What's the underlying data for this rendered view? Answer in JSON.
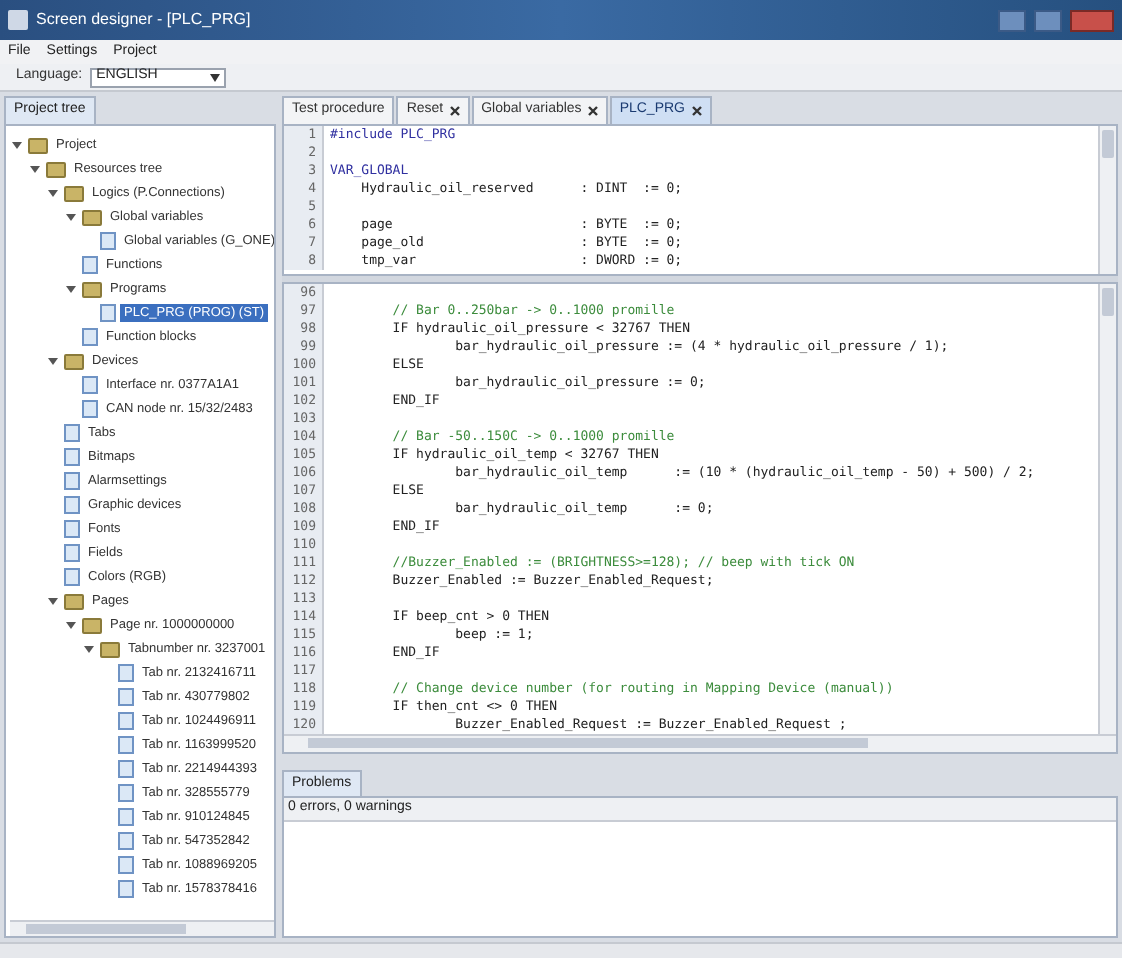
{
  "window": {
    "title": "Screen designer - [PLC_PRG]"
  },
  "menu": [
    "File",
    "Settings",
    "Project"
  ],
  "toolbar": {
    "label": "Language:",
    "value": "ENGLISH"
  },
  "sidebar": {
    "tab": "Project tree",
    "tree": [
      {
        "label": "Project",
        "expanded": true,
        "selected": false,
        "children": [
          {
            "label": "Resources tree",
            "expanded": true,
            "selected": false,
            "children": [
              {
                "label": "Logics (P.Connections)",
                "expanded": true,
                "selected": false,
                "children": [
                  {
                    "label": "Global variables",
                    "expanded": true,
                    "selected": false,
                    "children": [
                      {
                        "label": "Global variables (G_ONE)",
                        "selected": false
                      }
                    ]
                  },
                  {
                    "label": "Functions",
                    "selected": false
                  },
                  {
                    "label": "Programs",
                    "expanded": true,
                    "selected": false,
                    "children": [
                      {
                        "label": "PLC_PRG (PROG) (ST)",
                        "selected": true
                      }
                    ]
                  },
                  {
                    "label": "Function blocks",
                    "selected": false
                  }
                ]
              },
              {
                "label": "Devices",
                "expanded": true,
                "selected": false,
                "children": [
                  {
                    "label": "Interface nr. 0377A1A1",
                    "selected": false
                  },
                  {
                    "label": "CAN node nr. 15/32/2483",
                    "selected": false
                  }
                ]
              },
              {
                "label": "Tabs",
                "selected": false
              },
              {
                "label": "Bitmaps",
                "selected": false
              },
              {
                "label": "Alarmsettings",
                "selected": false
              },
              {
                "label": "Graphic devices",
                "selected": false
              },
              {
                "label": "Fonts",
                "selected": false
              },
              {
                "label": "Fields",
                "selected": false
              },
              {
                "label": "Colors (RGB)",
                "selected": false
              },
              {
                "label": "Pages",
                "expanded": true,
                "selected": false,
                "children": [
                  {
                    "label": "Page nr. 1000000000",
                    "expanded": true,
                    "selected": false,
                    "children": [
                      {
                        "label": "Tabnumber nr. 3237001",
                        "expanded": true,
                        "selected": false,
                        "children": [
                          {
                            "label": "Tab nr. 2132416711",
                            "selected": false
                          },
                          {
                            "label": "Tab nr. 430779802",
                            "selected": false
                          },
                          {
                            "label": "Tab nr. 1024496911",
                            "selected": false
                          },
                          {
                            "label": "Tab nr. 1163999520",
                            "selected": false
                          },
                          {
                            "label": "Tab nr. 2214944393",
                            "selected": false
                          },
                          {
                            "label": "Tab nr. 328555779",
                            "selected": false
                          },
                          {
                            "label": "Tab nr. 910124845",
                            "selected": false
                          },
                          {
                            "label": "Tab nr. 547352842",
                            "selected": false
                          },
                          {
                            "label": "Tab nr. 1088969205",
                            "selected": false
                          },
                          {
                            "label": "Tab nr. 1578378416",
                            "selected": false
                          }
                        ]
                      }
                    ]
                  }
                ]
              }
            ]
          }
        ]
      }
    ]
  },
  "editor_tabs": [
    {
      "label": "Test procedure",
      "selected": false,
      "closable": false
    },
    {
      "label": "Reset",
      "selected": false,
      "closable": true
    },
    {
      "label": "Global variables",
      "selected": false,
      "closable": true
    },
    {
      "label": "PLC_PRG",
      "selected": true,
      "closable": true
    }
  ],
  "declarations": [
    {
      "no": "1",
      "kind": "keyword",
      "text": "#include PLC_PRG"
    },
    {
      "no": "2"
    },
    {
      "no": "3",
      "kind": "keyword",
      "text": "VAR_GLOBAL"
    },
    {
      "no": "4",
      "kind": "code",
      "text": "    Hydraulic_oil_reserved      : DINT  := 0;"
    },
    {
      "no": "5"
    },
    {
      "no": "6",
      "kind": "code",
      "text": "    page                        : BYTE  := 0;"
    },
    {
      "no": "7",
      "kind": "code",
      "text": "    page_old                    : BYTE  := 0;"
    },
    {
      "no": "8",
      "kind": "code",
      "text": "    tmp_var                     : DWORD := 0;"
    }
  ],
  "code": [
    {
      "no": "96"
    },
    {
      "no": "97",
      "kind": "comment",
      "text": "        // Bar 0..250bar -> 0..1000 promille"
    },
    {
      "no": "98",
      "kind": "code",
      "text": "        IF hydraulic_oil_pressure < 32767 THEN"
    },
    {
      "no": "99",
      "kind": "code",
      "text": "                bar_hydraulic_oil_pressure := (4 * hydraulic_oil_pressure / 1);"
    },
    {
      "no": "100",
      "kind": "code",
      "text": "        ELSE"
    },
    {
      "no": "101",
      "kind": "code",
      "text": "                bar_hydraulic_oil_pressure := 0;"
    },
    {
      "no": "102",
      "kind": "code",
      "text": "        END_IF"
    },
    {
      "no": "103"
    },
    {
      "no": "104",
      "kind": "comment",
      "text": "        // Bar -50..150C -> 0..1000 promille"
    },
    {
      "no": "105",
      "kind": "code",
      "text": "        IF hydraulic_oil_temp < 32767 THEN"
    },
    {
      "no": "106",
      "kind": "code",
      "text": "                bar_hydraulic_oil_temp      := (10 * (hydraulic_oil_temp - 50) + 500) / 2;"
    },
    {
      "no": "107",
      "kind": "code",
      "text": "        ELSE"
    },
    {
      "no": "108",
      "kind": "code",
      "text": "                bar_hydraulic_oil_temp      := 0;"
    },
    {
      "no": "109",
      "kind": "code",
      "text": "        END_IF"
    },
    {
      "no": "110"
    },
    {
      "no": "111",
      "kind": "comment",
      "text": "        //Buzzer_Enabled := (BRIGHTNESS>=128); // beep with tick ON"
    },
    {
      "no": "112",
      "kind": "code",
      "text": "        Buzzer_Enabled := Buzzer_Enabled_Request;"
    },
    {
      "no": "113"
    },
    {
      "no": "114",
      "kind": "code",
      "text": "        IF beep_cnt > 0 THEN"
    },
    {
      "no": "115",
      "kind": "code",
      "text": "                beep := 1;"
    },
    {
      "no": "116",
      "kind": "code",
      "text": "        END_IF"
    },
    {
      "no": "117"
    },
    {
      "no": "118",
      "kind": "comment",
      "text": "        // Change device number (for routing in Mapping Device (manual))"
    },
    {
      "no": "119",
      "kind": "code",
      "text": "        IF then_cnt <> 0 THEN"
    },
    {
      "no": "120",
      "kind": "code",
      "text": "                Buzzer_Enabled_Request := Buzzer_Enabled_Request ;"
    }
  ],
  "problems": {
    "tab": "Problems",
    "summary": "0 errors, 0 warnings"
  }
}
